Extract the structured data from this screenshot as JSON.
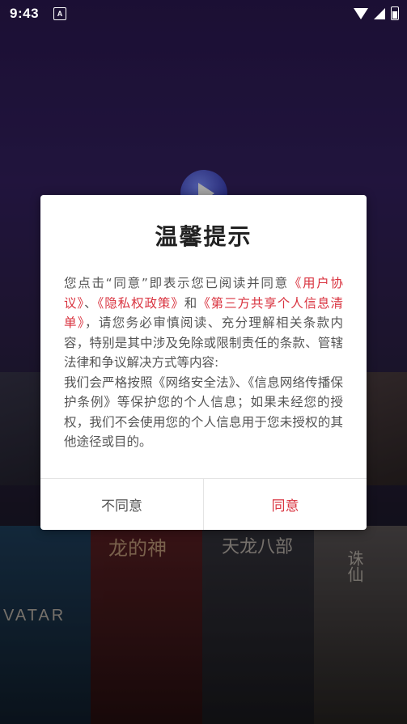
{
  "status_bar": {
    "time": "9:43",
    "notification_icon": "a-box-icon"
  },
  "dialog": {
    "title": "温馨提示",
    "body_pre": "您点击“同意”即表示您已阅读并同意",
    "link_user_agreement": "《用户协议》",
    "sep1": "、",
    "link_privacy_policy": "《隐私权政策》",
    "sep2": "和",
    "link_third_party_list": "《第三方共享个人信息清单》",
    "body_mid": "，请您务必审慎阅读、充分理解相关条款内容，特别是其中涉及免除或限制责任的条款、管辖法律和争议解决方式等内容:",
    "body_post": "我们会严格按照《网络安全法》、《信息网络传播保护条例》等保护您的个人信息；如果未经您的授权，我们不会使用您的个人信息用于您未授权的其他途径或目的。",
    "disagree_label": "不同意",
    "agree_label": "同意"
  },
  "background": {
    "poster_avatar_text": "VATAR",
    "poster_dragon_text": "龙的神",
    "poster_town_text": "天龙八部",
    "poster_xian_text": "诛仙"
  },
  "colors": {
    "accent": "#d9333f",
    "dialog_bg": "#ffffff",
    "body_text": "#555555"
  }
}
